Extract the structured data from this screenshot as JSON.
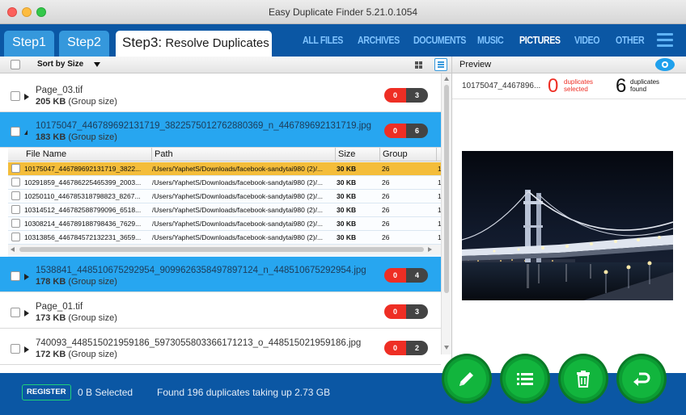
{
  "window": {
    "title": "Easy Duplicate Finder 5.21.0.1054"
  },
  "steps": {
    "step1": "Step1",
    "step2": "Step2",
    "step3_prefix": "Step3:",
    "step3_label": "Resolve Duplicates"
  },
  "categories": [
    {
      "label": "ALL FILES",
      "active": false
    },
    {
      "label": "ARCHIVES",
      "active": false
    },
    {
      "label": "DOCUMENTS",
      "active": false
    },
    {
      "label": "MUSIC",
      "active": false
    },
    {
      "label": "PICTURES",
      "active": true
    },
    {
      "label": "VIDEO",
      "active": false
    },
    {
      "label": "OTHER",
      "active": false
    }
  ],
  "toolbar": {
    "sort_label": "Sort by Size"
  },
  "groups": [
    {
      "name": "Page_03.tif",
      "size": "205 KB",
      "size_suffix": "(Group size)",
      "selected_count": "0",
      "dup_count": "3"
    },
    {
      "name": "10175047_446789692131719_3822575012762880369_n_446789692131719.jpg",
      "size": "183 KB",
      "size_suffix": "(Group size)",
      "selected_count": "0",
      "dup_count": "6"
    },
    {
      "name": "1538841_448510675292954_9099626358497897124_n_448510675292954.jpg",
      "size": "178 KB",
      "size_suffix": "(Group size)",
      "selected_count": "0",
      "dup_count": "4"
    },
    {
      "name": "Page_01.tif",
      "size": "173 KB",
      "size_suffix": "(Group size)",
      "selected_count": "0",
      "dup_count": "3"
    },
    {
      "name": "740093_448515021959186_5973055803366171213_o_448515021959186.jpg",
      "size": "172 KB",
      "size_suffix": "(Group size)",
      "selected_count": "0",
      "dup_count": "2"
    }
  ],
  "file_table": {
    "headers": [
      "File Name",
      "Path",
      "Size",
      "Group"
    ],
    "rows": [
      {
        "name": "10175047_446789692131719_3822...",
        "path": "/Users/YaphetS/Downloads/facebook-sandytai980 (2)/...",
        "size": "30 KB",
        "group": "26",
        "extra": "1"
      },
      {
        "name": "10291859_446786225465399_2003...",
        "path": "/Users/YaphetS/Downloads/facebook-sandytai980 (2)/...",
        "size": "30 KB",
        "group": "26",
        "extra": "1"
      },
      {
        "name": "10250110_446785318798823_8267...",
        "path": "/Users/YaphetS/Downloads/facebook-sandytai980 (2)/...",
        "size": "30 KB",
        "group": "26",
        "extra": "1"
      },
      {
        "name": "10314512_446782588799096_6518...",
        "path": "/Users/YaphetS/Downloads/facebook-sandytai980 (2)/...",
        "size": "30 KB",
        "group": "26",
        "extra": "1"
      },
      {
        "name": "10308214_446789188798436_7629...",
        "path": "/Users/YaphetS/Downloads/facebook-sandytai980 (2)/...",
        "size": "30 KB",
        "group": "26",
        "extra": "1"
      },
      {
        "name": "10313856_446784572132231_3659...",
        "path": "/Users/YaphetS/Downloads/facebook-sandytai980 (2)/...",
        "size": "30 KB",
        "group": "26",
        "extra": "1"
      }
    ]
  },
  "preview": {
    "label": "Preview",
    "file_name": "10175047_4467896...",
    "selected_num": "0",
    "selected_label_1": "duplicates",
    "selected_label_2": "selected",
    "found_num": "6",
    "found_label_1": "duplicates",
    "found_label_2": "found"
  },
  "bottom": {
    "register_label": "REGISTER",
    "selected_text": "0 B Selected",
    "summary_text": "Found  196  duplicates  taking  up  2.73  GB"
  },
  "colors": {
    "header_blue": "#0b57a4",
    "tab_blue": "#3598dc",
    "row_selected": "#27a6f0",
    "row_highlight": "#f4bd3a",
    "badge_red": "#ee2e24",
    "action_green": "#12b53d"
  },
  "icons": {
    "edit": "pencil-icon",
    "list": "list-icon",
    "delete": "trash-icon",
    "undo": "undo-icon",
    "preview_toggle": "eye-icon"
  }
}
